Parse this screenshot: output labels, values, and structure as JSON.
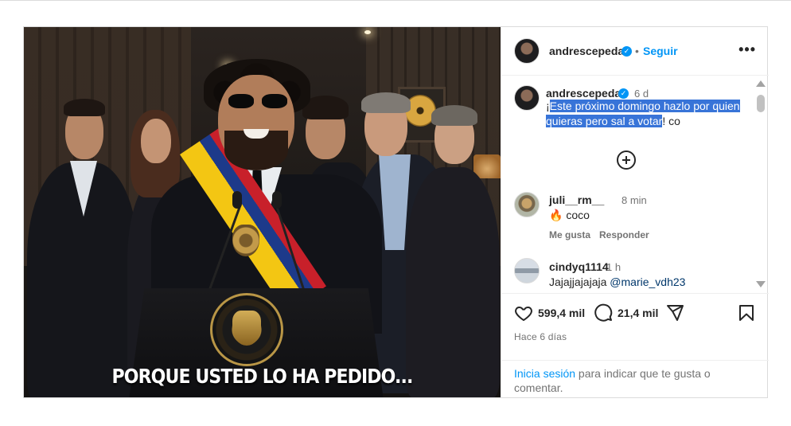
{
  "post": {
    "image_caption": "PORQUE USTED LO HA PEDIDO..."
  },
  "header": {
    "username": "andrescepeda",
    "dot": "•",
    "follow_label": "Seguir",
    "more_label": "•••"
  },
  "caption": {
    "username": "andrescepeda",
    "time": "6 d",
    "text_prefix": "¡",
    "text_highlighted": "Este próximo domingo hazlo por quien quieras pero sal a votar",
    "text_suffix": "! co"
  },
  "comments": [
    {
      "username": "juli__rm__",
      "time": "8 min",
      "emoji": "🔥",
      "text": "coco",
      "like_label": "Me gusta",
      "reply_label": "Responder"
    },
    {
      "username": "cindyq1114",
      "time": "1 h",
      "text": "Jajajjajajaja",
      "mention": "@marie_vdh23"
    }
  ],
  "stats": {
    "likes": "599,4 mil",
    "comments": "21,4 mil",
    "posted_ago": "Hace 6 días"
  },
  "login": {
    "link": "Inicia sesión",
    "rest": " para indicar que te gusta o comentar."
  },
  "colors": {
    "link_blue": "#0095f6",
    "verified_blue": "#0095f6",
    "selection": "#3874d8",
    "muted": "#737373"
  },
  "icons": [
    "verified-badge-icon",
    "more-options-icon",
    "add-comments-icon",
    "heart-icon",
    "comment-icon",
    "share-icon",
    "bookmark-icon"
  ]
}
